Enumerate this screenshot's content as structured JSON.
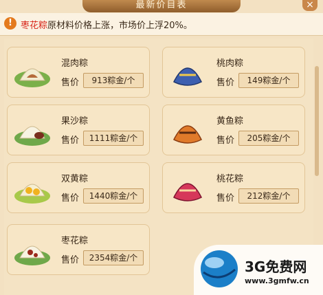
{
  "window": {
    "title": "最新价目表"
  },
  "notice": {
    "highlight": "枣花粽",
    "text": "原材料价格上涨，市场价上浮20%。"
  },
  "price_label": "售价",
  "items": [
    {
      "name": "混肉粽",
      "price": "913粽金/个",
      "icon": "rice-dumpling-green-icon"
    },
    {
      "name": "桃肉粽",
      "price": "149粽金/个",
      "icon": "rice-dumpling-blue-icon"
    },
    {
      "name": "果沙粽",
      "price": "1111粽金/个",
      "icon": "rice-dumpling-white-icon"
    },
    {
      "name": "黄鱼粽",
      "price": "205粽金/个",
      "icon": "rice-dumpling-orange-icon"
    },
    {
      "name": "双黄粽",
      "price": "1440粽金/个",
      "icon": "rice-dumpling-yolk-icon"
    },
    {
      "name": "桃花粽",
      "price": "212粽金/个",
      "icon": "rice-dumpling-pink-icon"
    },
    {
      "name": "枣花粽",
      "price": "2354粽金/个",
      "icon": "rice-dumpling-date-icon"
    }
  ],
  "watermark": {
    "title": "3G免费网",
    "url": "www.3gmfw.cn"
  }
}
